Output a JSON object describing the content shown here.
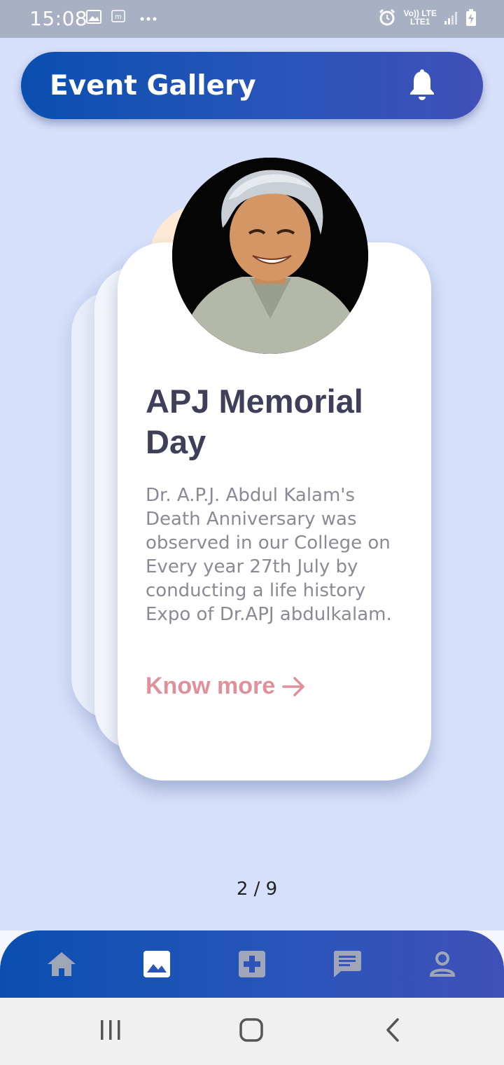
{
  "status_bar": {
    "time": "15:08",
    "net_top": "Vo)) LTE",
    "net_bottom": "LTE1",
    "icons": [
      "image-icon",
      "m-icon",
      "more-icon",
      "alarm-icon",
      "signal-icon",
      "battery-charging-icon"
    ]
  },
  "header": {
    "title": "Event Gallery",
    "bell_icon": "bell-icon"
  },
  "card": {
    "title": "APJ Memorial Day",
    "description": "Dr. A.P.J. Abdul Kalam's Death Anniversary was observed in our College on Every year 27th July by conducting a life history Expo of Dr.APJ abdulkalam.",
    "link_label": "Know more",
    "link_icon": "arrow-right-icon",
    "image_icon": "portrait-photo"
  },
  "pager": {
    "text": "2 / 9"
  },
  "bottom_nav": {
    "items": [
      {
        "name": "home",
        "icon": "home-icon",
        "active": false
      },
      {
        "name": "gallery",
        "icon": "image-icon",
        "active": true
      },
      {
        "name": "medical",
        "icon": "medical-plus-icon",
        "active": false
      },
      {
        "name": "chat",
        "icon": "chat-icon",
        "active": false
      },
      {
        "name": "profile",
        "icon": "person-icon",
        "active": false
      }
    ]
  },
  "colors": {
    "background": "#d6e0fa",
    "accent_start": "#0a4fb0",
    "accent_end": "#4050b8",
    "link": "#e0909b",
    "title": "#3f3f5a",
    "inactive_icon": "#9ea6b8"
  }
}
